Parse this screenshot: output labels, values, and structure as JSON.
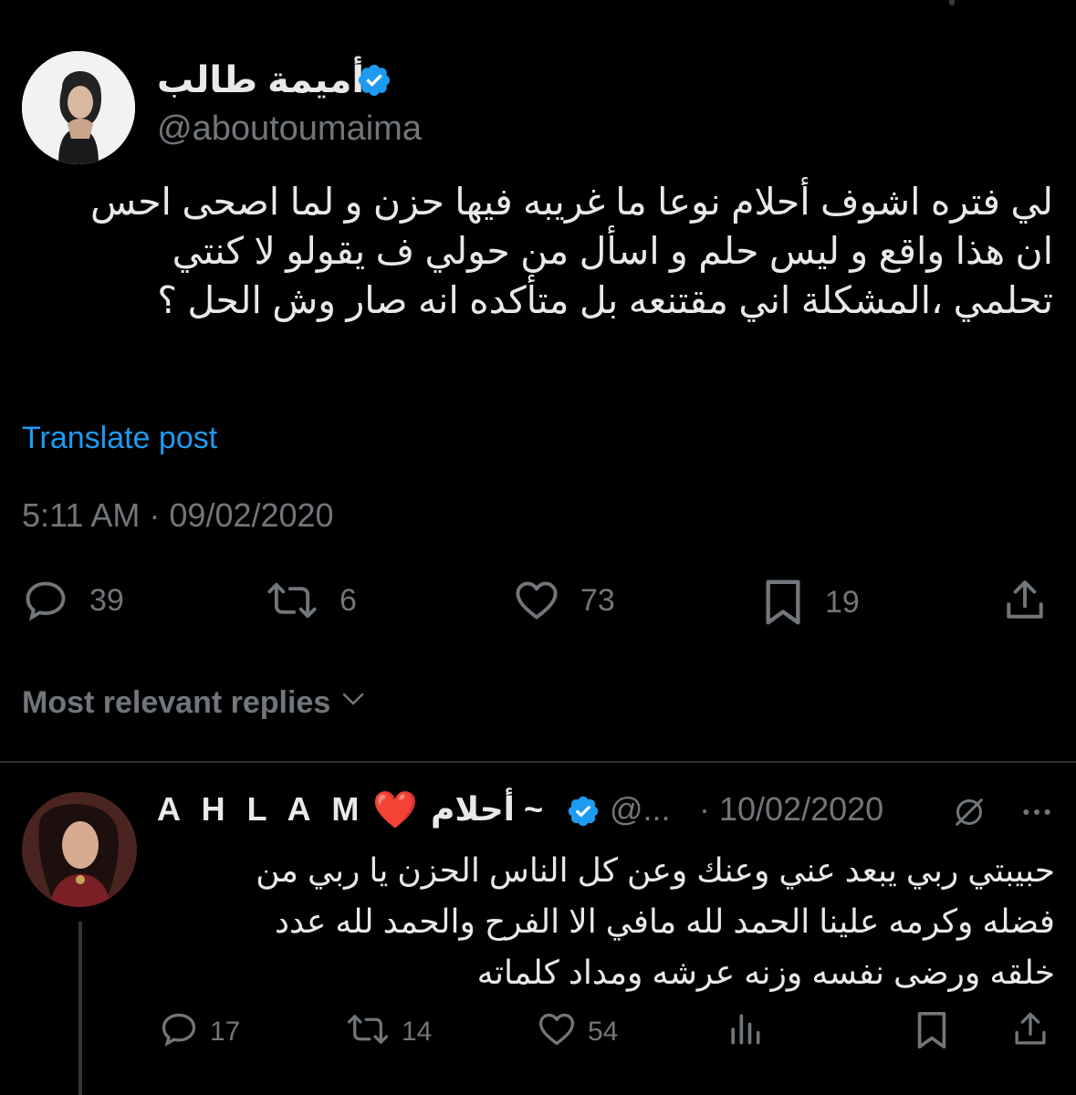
{
  "post": {
    "author_name": "أميمة طالب",
    "handle": "@aboutoumaima",
    "text_lines": [
      "لي فتره اشوف أحلام نوعا ما غريبه فيها حزن و لما اصحى احس",
      "ان هذا واقع و ليس حلم و اسأل من حولي ف يقولو لا كنتي",
      "تحلمي ،المشكلة اني مقتنعه بل متأكده انه صار  وش الحل ؟"
    ],
    "translate_label": "Translate post",
    "timestamp": "5:11 AM · 09/02/2020",
    "stats": {
      "replies": "39",
      "reposts": "6",
      "likes": "73",
      "bookmarks": "19"
    }
  },
  "replies_sort": {
    "label": "Most relevant replies"
  },
  "reply": {
    "name_en": "A H L A M ~",
    "heart": "❤️",
    "name_ar": "~ أحلام",
    "handle": "@...",
    "date": "· 10/02/2020",
    "text_lines": [
      "حبيبتي ربي يبعد عني وعنك وعن كل الناس الحزن يا ربي من",
      "فضله وكرمه علينا الحمد لله مافي الا الفرح والحمد لله عدد",
      "خلقه ورضى نفسه وزنه عرشه ومداد كلماته"
    ],
    "stats": {
      "replies": "17",
      "reposts": "14",
      "likes": "54"
    }
  },
  "colors": {
    "background": "#000000",
    "text": "#e7e9ea",
    "muted": "#71767b",
    "accent": "#1d9bf0",
    "divider": "#2f3336"
  },
  "icons": [
    "verified-badge-icon",
    "reply-icon",
    "repost-icon",
    "like-icon",
    "bookmark-icon",
    "share-icon",
    "chevron-down-icon",
    "views-icon",
    "grok-icon",
    "more-icon"
  ]
}
